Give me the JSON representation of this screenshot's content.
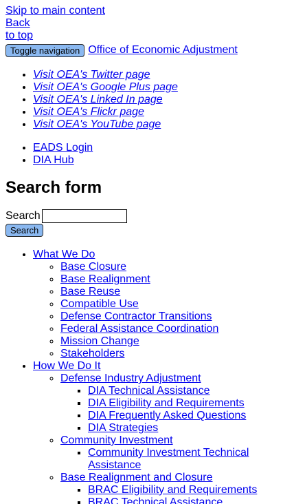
{
  "skip_links": {
    "skip_main": "Skip to main content",
    "back": "Back",
    "to_top": "to top"
  },
  "navbar": {
    "toggle_label": "Toggle navigation",
    "brand": "Office of Economic Adjustment"
  },
  "social": [
    "Visit OEA's Twitter page",
    "Visit OEA's Google Plus page",
    "Visit OEA's Linked In page",
    "Visit OEA's Flickr page",
    "Visit OEA's YouTube page"
  ],
  "utility": [
    "EADS Login",
    "DIA Hub"
  ],
  "search": {
    "heading": "Search form",
    "label": "Search",
    "value": "",
    "button": "Search"
  },
  "menu": {
    "what_we_do": {
      "label": "What We Do",
      "items": [
        "Base Closure",
        "Base Realignment",
        "Base Reuse",
        "Compatible Use",
        "Defense Contractor Transitions",
        "Federal Assistance Coordination",
        "Mission Change",
        "Stakeholders"
      ]
    },
    "how_we_do_it": {
      "label": "How We Do It",
      "groups": [
        {
          "label": "Defense Industry Adjustment",
          "items": [
            "DIA Technical Assistance",
            "DIA Eligibility and Requirements",
            "DIA Frequently Asked Questions",
            "DIA Strategies"
          ]
        },
        {
          "label": "Community Investment",
          "items": [
            "Community Investment Technical Assistance"
          ]
        },
        {
          "label": "Base Realignment and Closure",
          "items": [
            "BRAC Eligibility and Requirements",
            "BRAC Technical Assistance"
          ]
        }
      ]
    }
  }
}
